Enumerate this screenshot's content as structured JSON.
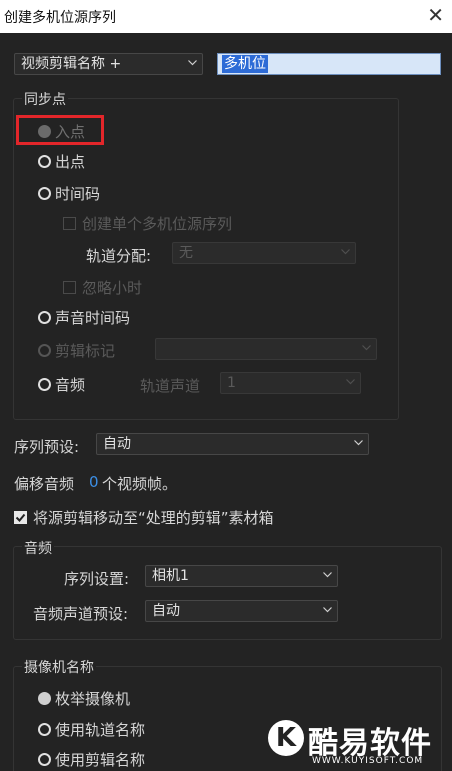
{
  "window": {
    "title": "创建多机位源序列",
    "close_glyph": "✕"
  },
  "name_source": {
    "value": "视频剪辑名称 +",
    "name_value": "多机位"
  },
  "sync_group": {
    "label": "同步点",
    "options": {
      "in_point": "入点",
      "out_point": "出点",
      "timecode": "时间码",
      "create_single": "创建单个多机位源序列",
      "track_assign_label": "轨道分配:",
      "track_assign_value": "无",
      "ignore_hours": "忽略小时",
      "audio_timecode": "声音时间码",
      "clip_marker": "剪辑标记",
      "audio": "音频",
      "track_channel_label": "轨道声道",
      "track_channel_value": "1"
    }
  },
  "sequence_preset": {
    "label": "序列预设:",
    "value": "自动"
  },
  "offset_audio": {
    "prefix": "偏移音频",
    "value": "0",
    "suffix": "个视频帧。"
  },
  "move_clips": {
    "label": "将源剪辑移动至“处理的剪辑”素材箱",
    "checked": true
  },
  "audio_group": {
    "label": "音频",
    "sequence_settings_label": "序列设置:",
    "sequence_settings_value": "相机1",
    "channel_preset_label": "音频声道预设:",
    "channel_preset_value": "自动"
  },
  "camera_group": {
    "label": "摄像机名称",
    "enumerate": "枚举摄像机",
    "use_track_name": "使用轨道名称",
    "use_clip_name": "使用剪辑名称"
  },
  "watermark": {
    "logo": "K",
    "name": "酷易软件园",
    "url": "WWW.KUYISOFT.COM"
  },
  "colors": {
    "highlight": "#e3262a",
    "link_blue": "#3c8fe6",
    "selection": "#2d6bd6"
  }
}
